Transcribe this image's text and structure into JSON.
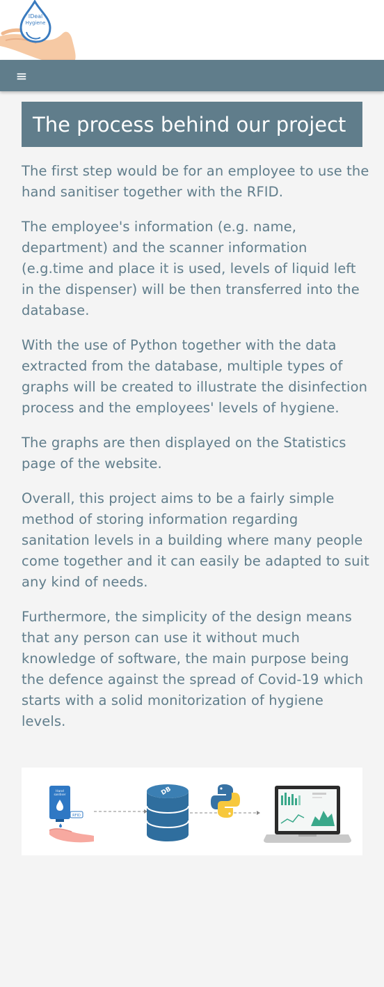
{
  "logo": {
    "text_line1": "IDeal",
    "text_line2": "Hygiene"
  },
  "navbar": {
    "menu_icon": "hamburger-menu-icon",
    "menu_glyph": "≡"
  },
  "main": {
    "title": "The process behind our project",
    "paragraphs": [
      "The first step would be for an employee to use the hand sanitiser together with the RFID.",
      "The employee's information (e.g. name, department) and the scanner information (e.g.time and place it is used, levels of liquid left in the dispenser) will be then transferred into the database.",
      "With the use of Python together with the data extracted from the database, multiple types of graphs will be created to illustrate the disinfection process and the employees' levels of hygiene.",
      "The graphs are then displayed on the Statistics page of the website.",
      "Overall, this project aims to be a fairly simple method of storing information regarding sanitation levels in a building where many people come together and it can easily be adapted to suit any kind of needs.",
      "Furthermore, the simplicity of the design means that any person can use it without much knowledge of software, the main purpose being the defence against the spread of Covid-19 which starts with a solid monitorization of hygiene levels."
    ]
  },
  "diagram": {
    "dispenser_label_1": "Hand",
    "dispenser_label_2": "sanitiser",
    "rfid_label": "RFID",
    "db_label": "DB"
  },
  "colors": {
    "accent": "#607d8b",
    "background": "#f4f4f4",
    "text": "#607d8b",
    "hand": "#f6c9a4",
    "logo_blue": "#3a7bbf",
    "db_blue": "#2f6e9e",
    "python_blue": "#3772a4",
    "python_yellow": "#f7c83d",
    "chart_green": "#3aa88a"
  }
}
